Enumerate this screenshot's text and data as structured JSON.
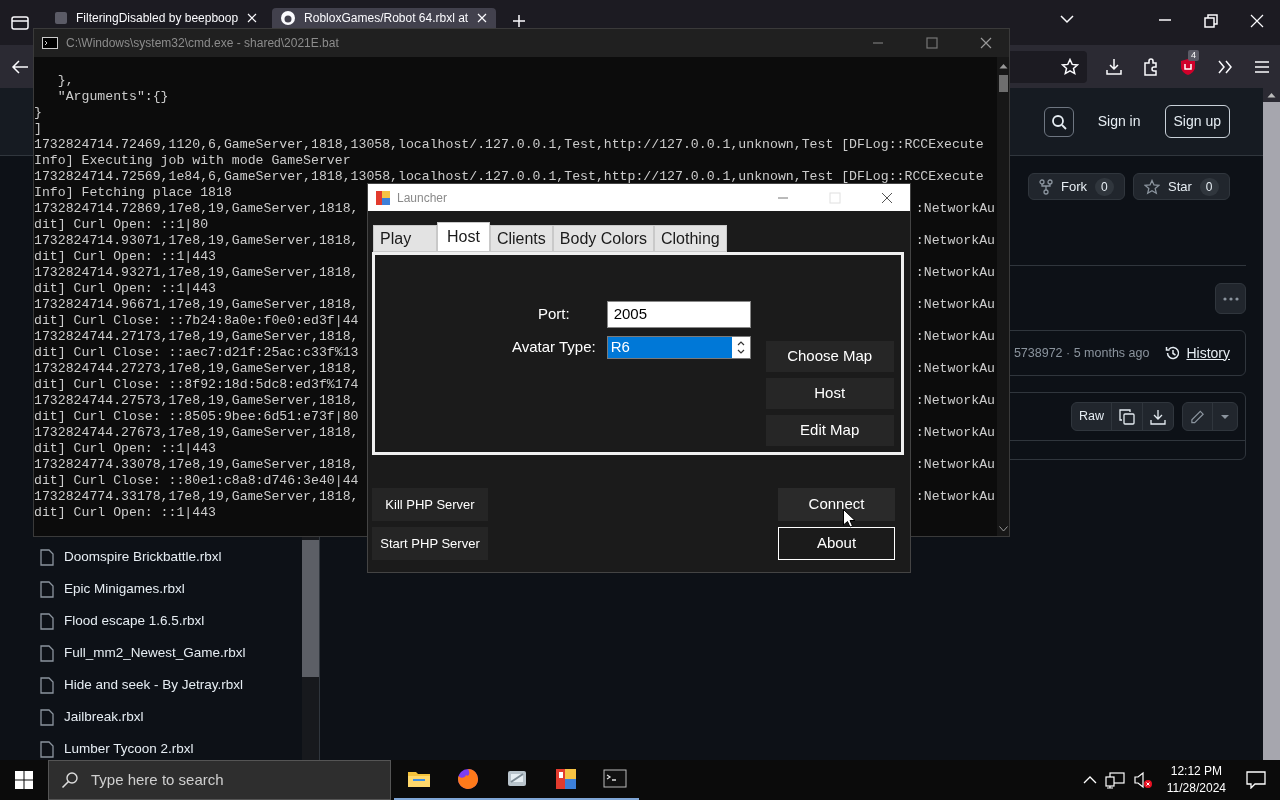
{
  "browser": {
    "tabs": [
      {
        "title": "FilteringDisabled by beepboop",
        "selected": false
      },
      {
        "title": "RobloxGames/Robot 64.rbxl at",
        "selected": true
      }
    ],
    "extension_badge": "4"
  },
  "github": {
    "header": {
      "sign_in": "Sign in",
      "sign_up": "Sign up"
    },
    "repo_actions": [
      {
        "label": "Fork",
        "count": "0",
        "kind": "fork"
      },
      {
        "label": "Star",
        "count": "0",
        "kind": "star"
      }
    ],
    "commit": {
      "text": "5738972 · 5 months ago",
      "history": "History"
    },
    "file_toolbar": {
      "raw": "Raw"
    },
    "files": [
      "Doomspire Brickbattle.rbxl",
      "Epic Minigames.rbxl",
      "Flood escape 1.6.5.rbxl",
      "Full_mm2_Newest_Game.rbxl",
      "Hide and seek - By Jetray.rbxl",
      "Jailbreak.rbxl",
      "Lumber Tycoon 2.rbxl"
    ]
  },
  "console": {
    "title": "C:\\Windows\\system32\\cmd.exe - shared\\2021E.bat",
    "lines": [
      {
        "text": "   },"
      },
      {
        "text": "   \"Arguments\":{}"
      },
      {
        "text": "}"
      },
      {
        "text": "]"
      },
      {
        "text": "1732824714.72469,1120,6,GameServer,1818,13058,localhost/.127.0.0.1,Test,http://127.0.0.1,unknown,Test [DFLog::RCCExecute"
      },
      {
        "text": "Info] Executing job with mode GameServer"
      },
      {
        "text": "1732824714.72569,1e84,6,GameServer,1818,13058,localhost/.127.0.0.1,Test,http://127.0.0.1,unknown,Test [DFLog::RCCExecute"
      },
      {
        "text": "Info] Fetching place 1818"
      },
      {
        "text": "1732824714.72869,17e8,19,GameServer,1818,",
        "right": ":NetworkAu"
      },
      {
        "text": "dit] Curl Open: ::1|80"
      },
      {
        "text": "1732824714.93071,17e8,19,GameServer,1818,",
        "right": ":NetworkAu"
      },
      {
        "text": "dit] Curl Open: ::1|443"
      },
      {
        "text": "1732824714.93271,17e8,19,GameServer,1818,",
        "right": ":NetworkAu"
      },
      {
        "text": "dit] Curl Open: ::1|443"
      },
      {
        "text": "1732824714.96671,17e8,19,GameServer,1818,",
        "right": ":NetworkAu"
      },
      {
        "text": "dit] Curl Close: ::7b24:8a0e:f0e0:ed3f|44"
      },
      {
        "text": "1732824744.27173,17e8,19,GameServer,1818,",
        "right": ":NetworkAu"
      },
      {
        "text": "dit] Curl Close: ::aec7:d21f:25ac:c33f%13"
      },
      {
        "text": "1732824744.27273,17e8,19,GameServer,1818,",
        "right": ":NetworkAu"
      },
      {
        "text": "dit] Curl Close: ::8f92:18d:5dc8:ed3f%174"
      },
      {
        "text": "1732824744.27573,17e8,19,GameServer,1818,",
        "right": ":NetworkAu"
      },
      {
        "text": "dit] Curl Close: ::8505:9bee:6d51:e73f|80"
      },
      {
        "text": "1732824744.27673,17e8,19,GameServer,1818,",
        "right": ":NetworkAu"
      },
      {
        "text": "dit] Curl Open: ::1|443"
      },
      {
        "text": "1732824774.33078,17e8,19,GameServer,1818,",
        "right": ":NetworkAu"
      },
      {
        "text": "dit] Curl Close: ::80e1:c8a8:d746:3e40|44"
      },
      {
        "text": "1732824774.33178,17e8,19,GameServer,1818,",
        "right": ":NetworkAu"
      },
      {
        "text": "dit] Curl Open: ::1|443"
      }
    ]
  },
  "launcher": {
    "title": "Launcher",
    "tabs": [
      {
        "label": "Play",
        "selected": false
      },
      {
        "label": "Host",
        "selected": true
      },
      {
        "label": "Clients",
        "selected": false
      },
      {
        "label": "Body Colors",
        "selected": false
      },
      {
        "label": "Clothing",
        "selected": false
      }
    ],
    "fields": [
      {
        "label": "Port:",
        "value": "2005",
        "kind": "text",
        "focused": false
      },
      {
        "label": "Avatar Type:",
        "value": "R6",
        "kind": "spin",
        "focused": true
      }
    ],
    "map_buttons": [
      "Choose Map",
      "Host",
      "Edit Map"
    ],
    "server_buttons": [
      "Kill PHP Server",
      "Start PHP Server"
    ],
    "main_buttons": [
      {
        "label": "Connect",
        "kind": "plain"
      },
      {
        "label": "About",
        "kind": "outlined"
      }
    ]
  },
  "taskbar": {
    "search": {
      "placeholder": "Type here to search"
    },
    "apps": [
      {
        "kind": "folder",
        "running": true
      },
      {
        "kind": "browser",
        "running": true
      },
      {
        "kind": "tool",
        "running": true
      },
      {
        "kind": "launcher",
        "running": true
      },
      {
        "kind": "terminal",
        "running": true
      }
    ],
    "time": "12:12 PM",
    "date": "11/28/2024"
  }
}
